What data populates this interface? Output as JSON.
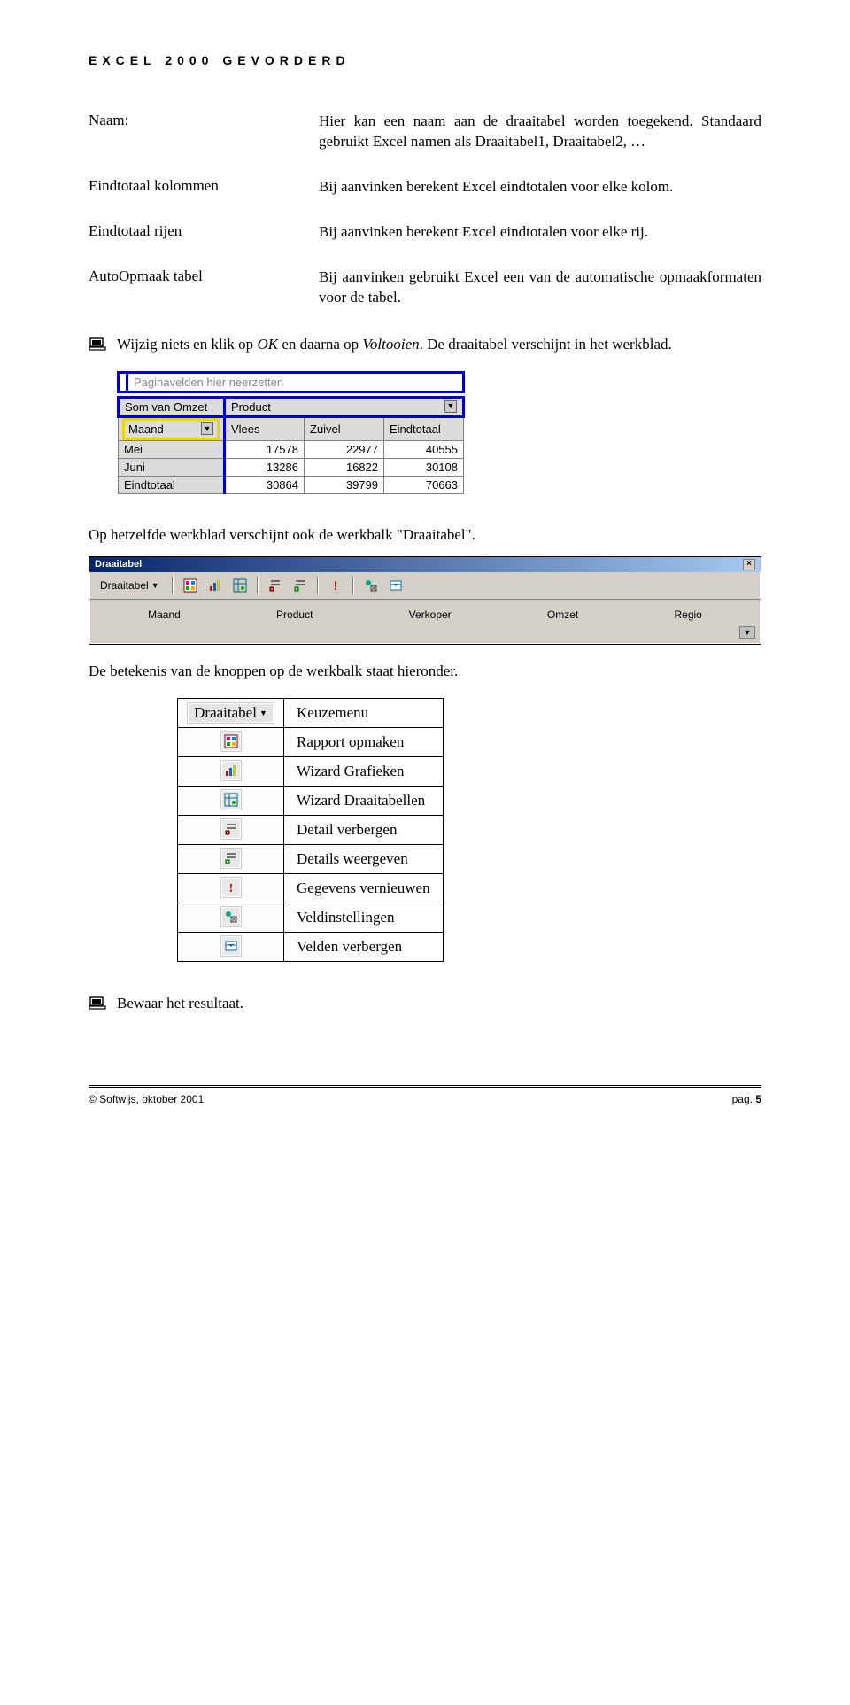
{
  "header": "EXCEL 2000 GEVORDERD",
  "definitions": [
    {
      "term": "Naam:",
      "desc": "Hier kan een naam aan de draaitabel worden toegekend. Standaard gebruikt Excel namen als Draaitabel1, Draaitabel2, …"
    },
    {
      "term": "Eindtotaal kolommen",
      "desc": "Bij aanvinken berekent Excel eindtotalen voor elke kolom."
    },
    {
      "term": "Eindtotaal rijen",
      "desc": "Bij aanvinken berekent Excel eindtotalen voor elke rij."
    },
    {
      "term": "AutoOpmaak tabel",
      "desc": "Bij aanvinken gebruikt Excel een van de automatische opmaakformaten voor de tabel."
    }
  ],
  "action1": {
    "pre": "Wijzig niets en klik op ",
    "italic1": "OK",
    "mid": " en daarna op ",
    "italic2": "Voltooien",
    "post": ". De draaitabel verschijnt in het werkblad."
  },
  "pivot": {
    "dropzone": "Paginavelden hier neerzetten",
    "corner": "Som van Omzet",
    "product_label": "Product",
    "maand_label": "Maand",
    "col_headers": [
      "Vlees",
      "Zuivel",
      "Eindtotaal"
    ]
  },
  "chart_data": {
    "type": "table",
    "title": "Som van Omzet (pivot)",
    "row_field": "Maand",
    "col_field": "Product",
    "categories": [
      "Mei",
      "Juni",
      "Eindtotaal"
    ],
    "series": [
      {
        "name": "Vlees",
        "values": [
          17578,
          13286,
          30864
        ]
      },
      {
        "name": "Zuivel",
        "values": [
          22977,
          16822,
          39799
        ]
      },
      {
        "name": "Eindtotaal",
        "values": [
          40555,
          30108,
          70663
        ]
      }
    ]
  },
  "body_text1": "Op hetzelfde werkblad verschijnt ook de werkbalk \"Draaitabel\".",
  "toolbar": {
    "title": "Draaitabel",
    "menu_label": "Draaitabel",
    "fields": [
      "Maand",
      "Product",
      "Verkoper",
      "Omzet",
      "Regio"
    ]
  },
  "body_text2": "De betekenis van de knoppen op de werkbalk staat hieronder.",
  "legend": [
    "Keuzemenu",
    "Rapport opmaken",
    "Wizard Grafieken",
    "Wizard Draaitabellen",
    "Detail verbergen",
    "Details weergeven",
    "Gegevens vernieuwen",
    "Veldinstellingen",
    "Velden verbergen"
  ],
  "action2": "Bewaar het resultaat.",
  "footer": {
    "left": "© Softwijs, oktober 2001",
    "right_label": "pag.",
    "right_num": "5"
  }
}
